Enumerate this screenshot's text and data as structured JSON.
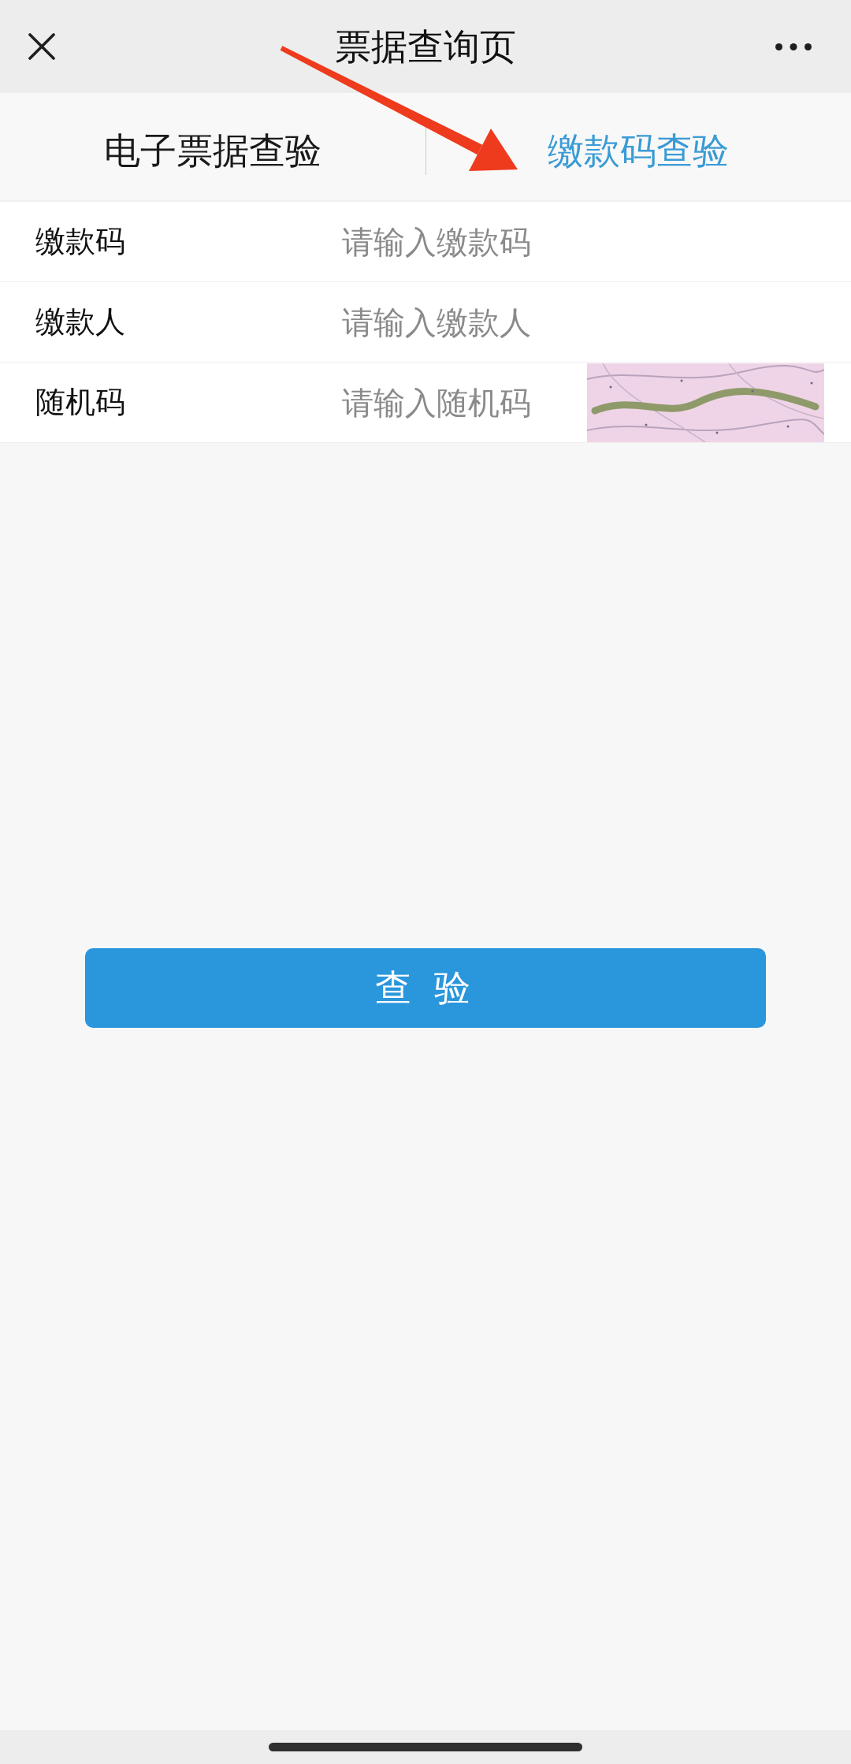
{
  "top_bar": {
    "title": "票据查询页"
  },
  "tabs": [
    {
      "label": "电子票据查验",
      "selected": false
    },
    {
      "label": "缴款码查验",
      "selected": true
    }
  ],
  "form": {
    "fields": [
      {
        "kind": "text",
        "label": "缴款码",
        "placeholder": "请输入缴款码"
      },
      {
        "kind": "text",
        "label": "缴款人",
        "placeholder": "请输入缴款人"
      },
      {
        "kind": "captcha",
        "label": "随机码",
        "placeholder": "请输入随机码"
      }
    ]
  },
  "submit_button": {
    "label": "查 验"
  },
  "annotations": [
    {
      "kind": "arrow"
    }
  ]
}
